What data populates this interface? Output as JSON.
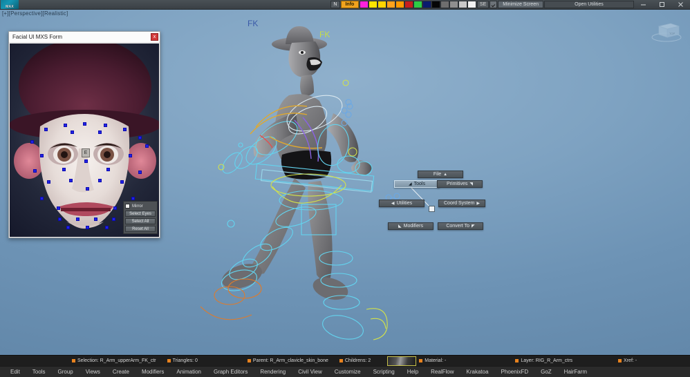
{
  "app": {
    "logo_text": "MAX",
    "viewport_label": "[+][Perspective][Realistic]"
  },
  "toolbar": {
    "n_button": "N",
    "info_button": "Info",
    "se_button": "SE",
    "minimize_screen": "Minimize Screen",
    "open_utilities": "Open Utilities",
    "swatches": [
      "#ff22dd",
      "#ffe400",
      "#ffd400",
      "#ffa21c",
      "#ff9a00",
      "#c61e1e",
      "#2ecc44",
      "#0a1a6e",
      "#060606",
      "#6e6e6e",
      "#8f8f8f",
      "#c9c9c9",
      "#f2f2f2"
    ]
  },
  "window_controls": {
    "minimize": "minimize",
    "restore": "restore",
    "close": "close"
  },
  "face_window": {
    "title": "Facial UI MXS Form",
    "close_label": "x",
    "eye_glyph_label": "E",
    "mirror_label": "Mirror",
    "buttons": [
      {
        "label": "Select Eyes"
      },
      {
        "label": "Select All"
      },
      {
        "label": "Reset All"
      }
    ]
  },
  "quad_menu": {
    "items": [
      {
        "label": "File",
        "arrow": "▲",
        "arrow_pos": "after",
        "hot": false
      },
      {
        "label": "Tools",
        "arrow": "◢",
        "arrow_pos": "before",
        "hot": true
      },
      {
        "label": "Primitives",
        "arrow": "◥",
        "arrow_pos": "after",
        "hot": false
      },
      {
        "label": "Utilities",
        "arrow": "◀",
        "arrow_pos": "before",
        "hot": false
      },
      {
        "label": "Coord System",
        "arrow": "▶",
        "arrow_pos": "after",
        "hot": false
      },
      {
        "label": "Modifiers",
        "arrow": "◣",
        "arrow_pos": "before",
        "hot": false
      },
      {
        "label": "Convert To",
        "arrow": "◤",
        "arrow_pos": "after",
        "hot": false
      }
    ]
  },
  "viewport_annotations": {
    "fk_left": "FK",
    "fk_right": "FK"
  },
  "status_bar": {
    "selection_label": "Selection: R_Arm_upperArm_FK_ctr",
    "triangles_label": "Triangles: 0",
    "parent_label": "Parent: R_Arm_clavicle_skin_bone",
    "children_label": "Childrens: 2",
    "material_label": "Material: -",
    "layer_label": "Layer: RIG_R_Arm_ctrs",
    "xref_label": "Xref: -"
  },
  "menu_bar": {
    "items": [
      "Edit",
      "Tools",
      "Group",
      "Views",
      "Create",
      "Modifiers",
      "Animation",
      "Graph Editors",
      "Rendering",
      "Civil View",
      "Customize",
      "Scripting",
      "Help",
      "RealFlow",
      "Krakatoa",
      "PhoenixFD",
      "GoZ",
      "HairFarm"
    ]
  },
  "colors": {
    "accent_orange": "#e8821e",
    "info_yellow": "#f0a31e",
    "marker_blue": "#2222e6",
    "viewport_blue": "#7fa3c2",
    "close_red": "#d23b3b"
  }
}
